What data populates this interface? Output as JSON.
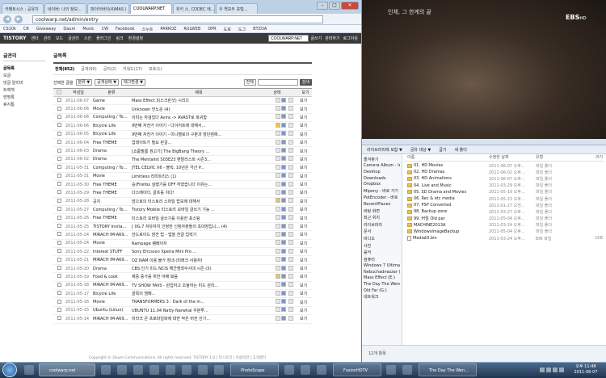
{
  "tabs": [
    "카페트시스 : 공유지",
    "네이버: 나의 정보...",
    "파이어바이(4)MAS (",
    "COOLWARP.NET",
    "위키 스, CODEC 에...",
    "우 퀵모두 포털..."
  ],
  "window": {
    "min": "–",
    "max": "□",
    "close": "✕"
  },
  "address": {
    "url": "coolwarp.net/admin/entry",
    "back": "◀",
    "forward": "▶"
  },
  "bookmarks": [
    "CS10k",
    "CR",
    "Giveaway",
    "Daum",
    "Music",
    "CW",
    "Facebook",
    "스누트",
    "PARKOZ",
    "RULWEB",
    "DPR",
    "도로",
    "도그",
    "BTZOA"
  ],
  "tistory": {
    "logo": "TISTORY",
    "menu": [
      "센터",
      "관리",
      "모드",
      "글관리",
      "스킨",
      "플러그인",
      "링크",
      "환경설정"
    ],
    "blog_input": "COOLWARP.NET",
    "right": [
      "글쓰기",
      "관리하기",
      "로그아웃"
    ]
  },
  "sidebar": {
    "heading": "글관리",
    "items": [
      "글목록",
      "모글",
      "댓글 알리미",
      "트랙백",
      "방명록",
      "휴지통"
    ]
  },
  "main": {
    "title": "글목록",
    "filters": [
      "전체(852)",
      "공개(90)",
      "공지(2)",
      "키워드(17)",
      "보호(1)"
    ],
    "bulk": "선택한 글을",
    "dd1": "분류 ▼",
    "dd2": "공개상태 ▼",
    "dd3": "태그변경 ▼",
    "search_dd": "전체",
    "search_btn": "검색",
    "headers": [
      "",
      "작성일",
      "분류",
      "제목",
      "상태",
      "",
      "보기"
    ],
    "rows": [
      {
        "date": "2011-06-07",
        "cat": "Game",
        "title": "Mass Effect 3(스크린샷) 시리즈"
      },
      {
        "date": "2011-06-06",
        "cat": "Movie",
        "title": "Unknown 언노운 (4)"
      },
      {
        "date": "2011-06-06",
        "cat": "Computing / To...",
        "title": "이미는 자검었다 Avira -> AVAST로 복귀함"
      },
      {
        "date": "2011-06-06",
        "cat": "Bicycle Life",
        "title": "9번째 자전거 이야기 - 다이어트에 대해서..."
      },
      {
        "date": "2011-06-05",
        "cat": "Bicycle Life",
        "title": "9번째 자전거 이야기 - 미니벨로의 구분과 장단점에..."
      },
      {
        "date": "2011-06-04",
        "cat": "Free THEME",
        "title": "업데이트가 필요 된걸..."
      },
      {
        "date": "2011-06-03",
        "cat": "Drama",
        "title": "[쇼룸필름 권고기] The BigBang Theory ..."
      },
      {
        "date": "2011-06-02",
        "cat": "Drama",
        "title": "The Mentalist S03E23 맨탈리스트 시즌3..."
      },
      {
        "date": "2011-05-31",
        "cat": "Computing / To...",
        "title": "JTEL CELVIC X6 - 블릭, 10년은 극산 P..."
      },
      {
        "date": "2011-05-31",
        "cat": "Movie",
        "title": "Limitless 리미트리스 (1)"
      },
      {
        "date": "2011-05-30",
        "cat": "Free THEME",
        "title": "승(Firefox 실행기를 OFF 하였습니다 이유는..."
      },
      {
        "date": "2011-05-29",
        "cat": "Free THEME",
        "title": "다스베이더, 골프를 치다!"
      },
      {
        "date": "2011-05-28",
        "cat": "공지",
        "title": "많으로의 티스토리 스마일 탑보에 대해서"
      },
      {
        "date": "2011-05-27",
        "cat": "Computing / To...",
        "title": "Tistory Mobile 티스토리 모바일 글쓰기 기능 ..."
      },
      {
        "date": "2011-05-26",
        "cat": "Free THEME",
        "title": "티스토리 모바일 글쓰기를 이용한 포스팅"
      },
      {
        "date": "2011-05-25",
        "cat": "TISTORY Invita...",
        "title": "[ 0G.7 자유자치 인정한 신청자분들의 초대장입니... (4)"
      },
      {
        "date": "2011-05-24",
        "cat": "MIRACH IM-A690...",
        "title": "안드로이드 잠깐 팁 - 앱을 한글 입력기"
      },
      {
        "date": "2011-05-24",
        "cat": "Movie",
        "title": "Rampage 램페이지"
      },
      {
        "date": "2011-05-22",
        "cat": "Interest STUFF",
        "title": "Sony Ericsson Xperia Mini Pro ..."
      },
      {
        "date": "2011-05-21",
        "cat": "MIRACH IM-A690...",
        "title": "OZ NAM 이용 불가 장내 (미래크 사용자)"
      },
      {
        "date": "2011-05-20",
        "cat": "Drama",
        "title": "CBS 인기 미드 NCIS 해군범죄수사대 시즌 (3)"
      },
      {
        "date": "2011-05-19",
        "cat": "Food & cook",
        "title": "제중 증가를 위한 야채 볶음"
      },
      {
        "date": "2011-05-18",
        "cat": "MIRACH IM-A690...",
        "title": "TV SHOW FAVS - 원업하고 조율하는 미드 관리..."
      },
      {
        "date": "2011-05-17",
        "cat": "Bicycle Life",
        "title": "골목의 엠페..."
      },
      {
        "date": "2011-05-16",
        "cat": "Movie",
        "title": "TRANSFORMERS 3 : Dark of the m..."
      },
      {
        "date": "2011-05-15",
        "cat": "Ubuntu (Linux)",
        "title": "UBUNTU 11.04 Natty Narwhal 우분투..."
      },
      {
        "date": "2011-05-14",
        "cat": "MIRACH IM-A690...",
        "title": "미라크 큰 프로파일파에 대한 작은 버전 안기..."
      }
    ],
    "view_label": "보기",
    "footer": "Copyright © Daum Communications. All rights reserved.  TISTORY 1.0  |  티스토리 | 이용약관 | 고객센터"
  },
  "video": {
    "title": "인체, 그 한계의 끝",
    "channel": "EBS",
    "hd": "HD"
  },
  "explorer": {
    "toolbar": [
      "라이브러리에 포함 ▼",
      "공유 대상 ▼",
      "굽기",
      "새 폴더"
    ],
    "nav": [
      "즐겨찾기",
      "Camera Album - Ie",
      "Desktop",
      "Downloads",
      "Dropbox",
      "Mipony - 바로 가기",
      "PotEncoder - 바로",
      "RecentPlaces",
      "바탕 화면",
      "최근 위치",
      "라이브러리",
      "문서",
      "비디오",
      "사진",
      "음악",
      "컴퓨터",
      "Windows 7 Ultimate",
      "Nebuchadnezzar (D",
      "Mass Effect (E:)",
      "The Day The Wendy",
      "Old Far (G:)",
      "네트워크"
    ],
    "columns": [
      "이름",
      "수정한 날짜",
      "유형",
      "크기"
    ],
    "files": [
      {
        "name": "01. HD Movies",
        "date": "2011-06-07 오후...",
        "type": "파일 폴더",
        "size": "",
        "kind": "folder"
      },
      {
        "name": "02. HD Dramas",
        "date": "2011-06-02 오후...",
        "type": "파일 폴더",
        "size": "",
        "kind": "folder"
      },
      {
        "name": "03. HD Animations",
        "date": "2011-06-07 오후...",
        "type": "파일 폴더",
        "size": "",
        "kind": "folder"
      },
      {
        "name": "04. Live and Music",
        "date": "2011-03-29 오후...",
        "type": "파일 폴더",
        "size": "",
        "kind": "folder"
      },
      {
        "name": "05. SD Drama and Movies",
        "date": "2011-05-19 오후...",
        "type": "파일 폴더",
        "size": "",
        "kind": "folder"
      },
      {
        "name": "06. Rec & etc media",
        "date": "2011-05-23 오후...",
        "type": "파일 폴더",
        "size": "",
        "kind": "folder"
      },
      {
        "name": "07. PSP Converted",
        "date": "2011-01-27 오전...",
        "type": "파일 폴더",
        "size": "",
        "kind": "folder"
      },
      {
        "name": "98. Backup zone",
        "date": "2011-03-27 오후...",
        "type": "파일 폴더",
        "size": "",
        "kind": "folder"
      },
      {
        "name": "99. 버릴 Old par",
        "date": "2011-05-04 오후...",
        "type": "파일 폴더",
        "size": "",
        "kind": "folder"
      },
      {
        "name": "MACHINE2013A",
        "date": "2011-03-24 오후...",
        "type": "파일 폴더",
        "size": "",
        "kind": "folder"
      },
      {
        "name": "WindowsImageBackup",
        "date": "2011-05-04 오후...",
        "type": "파일 폴더",
        "size": "",
        "kind": "folder"
      },
      {
        "name": "MediaID.bin",
        "date": "2011-03-24 오후...",
        "type": "BIN 파일",
        "size": "1KB",
        "kind": "file"
      }
    ],
    "status": "12개 항목"
  },
  "taskbar": {
    "items": [
      "coolwarp.net",
      "PhotoScape",
      "FusionHDTV",
      "The Day The Wen..."
    ],
    "time": "오후 11:48",
    "date": "2011-06-07"
  }
}
